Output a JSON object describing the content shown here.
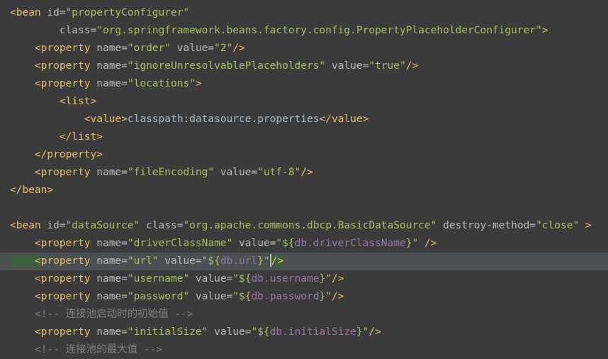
{
  "editor": {
    "language": "xml",
    "theme_background": "#3b3b3b",
    "current_line_background": "#4b4f51",
    "colors": {
      "tag": "#e8bf6a",
      "attribute": "#bababa",
      "string": "#a5c261",
      "placeholder": "#9876aa",
      "comment": "#808080",
      "text": "#a9b7c6",
      "bracket_highlight": "#3a5f3a"
    },
    "lines": [
      {
        "n": 1,
        "current": false,
        "tokens": [
          {
            "c": "tag",
            "t": "<bean"
          },
          {
            "c": "attr",
            "t": " id="
          },
          {
            "c": "str",
            "t": "\"propertyConfigurer\""
          }
        ]
      },
      {
        "n": 2,
        "current": false,
        "tokens": [
          {
            "c": "attr",
            "t": "        class="
          },
          {
            "c": "str",
            "t": "\"org.springframework.beans.factory.config.PropertyPlaceholderConfigurer\""
          },
          {
            "c": "tag",
            "t": ">"
          }
        ]
      },
      {
        "n": 3,
        "current": false,
        "tokens": [
          {
            "c": "tag",
            "t": "    <property"
          },
          {
            "c": "attr",
            "t": " name="
          },
          {
            "c": "str",
            "t": "\"order\""
          },
          {
            "c": "attr",
            "t": " value="
          },
          {
            "c": "str",
            "t": "\"2\""
          },
          {
            "c": "tag",
            "t": "/>"
          }
        ]
      },
      {
        "n": 4,
        "current": false,
        "tokens": [
          {
            "c": "tag",
            "t": "    <property"
          },
          {
            "c": "attr",
            "t": " name="
          },
          {
            "c": "str",
            "t": "\"ignoreUnresolvablePlaceholders\""
          },
          {
            "c": "attr",
            "t": " value="
          },
          {
            "c": "str",
            "t": "\"true\""
          },
          {
            "c": "tag",
            "t": "/>"
          }
        ]
      },
      {
        "n": 5,
        "current": false,
        "tokens": [
          {
            "c": "tag",
            "t": "    <property"
          },
          {
            "c": "attr",
            "t": " name="
          },
          {
            "c": "str",
            "t": "\"locations\""
          },
          {
            "c": "tag",
            "t": ">"
          }
        ]
      },
      {
        "n": 6,
        "current": false,
        "tokens": [
          {
            "c": "tag",
            "t": "        <list>"
          }
        ]
      },
      {
        "n": 7,
        "current": false,
        "tokens": [
          {
            "c": "tag",
            "t": "            <value>"
          },
          {
            "c": "text",
            "t": "classpath:datasource.properties"
          },
          {
            "c": "tag",
            "t": "</value>"
          }
        ]
      },
      {
        "n": 8,
        "current": false,
        "tokens": [
          {
            "c": "tag",
            "t": "        </list>"
          }
        ]
      },
      {
        "n": 9,
        "current": false,
        "tokens": [
          {
            "c": "tag",
            "t": "    </property>"
          }
        ]
      },
      {
        "n": 10,
        "current": false,
        "tokens": [
          {
            "c": "tag",
            "t": "    <property"
          },
          {
            "c": "attr",
            "t": " name="
          },
          {
            "c": "str",
            "t": "\"fileEncoding\""
          },
          {
            "c": "attr",
            "t": " value="
          },
          {
            "c": "str",
            "t": "\"utf-8\""
          },
          {
            "c": "tag",
            "t": "/>"
          }
        ]
      },
      {
        "n": 11,
        "current": false,
        "tokens": [
          {
            "c": "tag",
            "t": "</bean>"
          }
        ]
      },
      {
        "n": 12,
        "current": false,
        "tokens": []
      },
      {
        "n": 13,
        "current": false,
        "tokens": [
          {
            "c": "tag",
            "t": "<bean"
          },
          {
            "c": "attr",
            "t": " id="
          },
          {
            "c": "str",
            "t": "\"dataSource\""
          },
          {
            "c": "attr",
            "t": " class="
          },
          {
            "c": "str",
            "t": "\"org.apache.commons.dbcp.BasicDataSource\""
          },
          {
            "c": "attr",
            "t": " destroy-method="
          },
          {
            "c": "str",
            "t": "\"close\""
          },
          {
            "c": "tag",
            "t": " >"
          }
        ]
      },
      {
        "n": 14,
        "current": false,
        "tokens": [
          {
            "c": "tag",
            "t": "    <property"
          },
          {
            "c": "attr",
            "t": " name="
          },
          {
            "c": "str",
            "t": "\"driverClassName\""
          },
          {
            "c": "attr",
            "t": " value="
          },
          {
            "c": "str",
            "t": "\"${"
          },
          {
            "c": "ph",
            "t": "db.driverClassName"
          },
          {
            "c": "str",
            "t": "}\""
          },
          {
            "c": "tag",
            "t": " />"
          }
        ]
      },
      {
        "n": 15,
        "current": true,
        "tokens": [
          {
            "c": "hl-brack",
            "t": "    <"
          },
          {
            "c": "tag",
            "t": "property"
          },
          {
            "c": "attr",
            "t": " name="
          },
          {
            "c": "str",
            "t": "\"url\""
          },
          {
            "c": "attr",
            "t": " value="
          },
          {
            "c": "str",
            "t": "\"${"
          },
          {
            "c": "ph",
            "t": "db.url"
          },
          {
            "c": "str",
            "t": "}\""
          },
          {
            "c": "caret",
            "t": ""
          },
          {
            "c": "hl-brack",
            "t": "/>"
          }
        ]
      },
      {
        "n": 16,
        "current": false,
        "tokens": [
          {
            "c": "tag",
            "t": "    <property"
          },
          {
            "c": "attr",
            "t": " name="
          },
          {
            "c": "str",
            "t": "\"username\""
          },
          {
            "c": "attr",
            "t": " value="
          },
          {
            "c": "str",
            "t": "\"${"
          },
          {
            "c": "ph",
            "t": "db.username"
          },
          {
            "c": "str",
            "t": "}\""
          },
          {
            "c": "tag",
            "t": "/>"
          }
        ]
      },
      {
        "n": 17,
        "current": false,
        "tokens": [
          {
            "c": "tag",
            "t": "    <property"
          },
          {
            "c": "attr",
            "t": " name="
          },
          {
            "c": "str",
            "t": "\"password\""
          },
          {
            "c": "attr",
            "t": " value="
          },
          {
            "c": "str",
            "t": "\"${"
          },
          {
            "c": "ph",
            "t": "db.password"
          },
          {
            "c": "str",
            "t": "}\""
          },
          {
            "c": "tag",
            "t": "/>"
          }
        ]
      },
      {
        "n": 18,
        "current": false,
        "tokens": [
          {
            "c": "comment",
            "t": "    <!-- 连接池启动时的初始值 -->"
          }
        ]
      },
      {
        "n": 19,
        "current": false,
        "tokens": [
          {
            "c": "tag",
            "t": "    <property"
          },
          {
            "c": "attr",
            "t": " name="
          },
          {
            "c": "str",
            "t": "\"initialSize\""
          },
          {
            "c": "attr",
            "t": " value="
          },
          {
            "c": "str",
            "t": "\"${"
          },
          {
            "c": "ph",
            "t": "db.initialSize"
          },
          {
            "c": "str",
            "t": "}\""
          },
          {
            "c": "tag",
            "t": "/>"
          }
        ]
      },
      {
        "n": 20,
        "current": false,
        "tokens": [
          {
            "c": "comment",
            "t": "    <!-- 连接池的最大值 -->"
          }
        ]
      }
    ]
  }
}
